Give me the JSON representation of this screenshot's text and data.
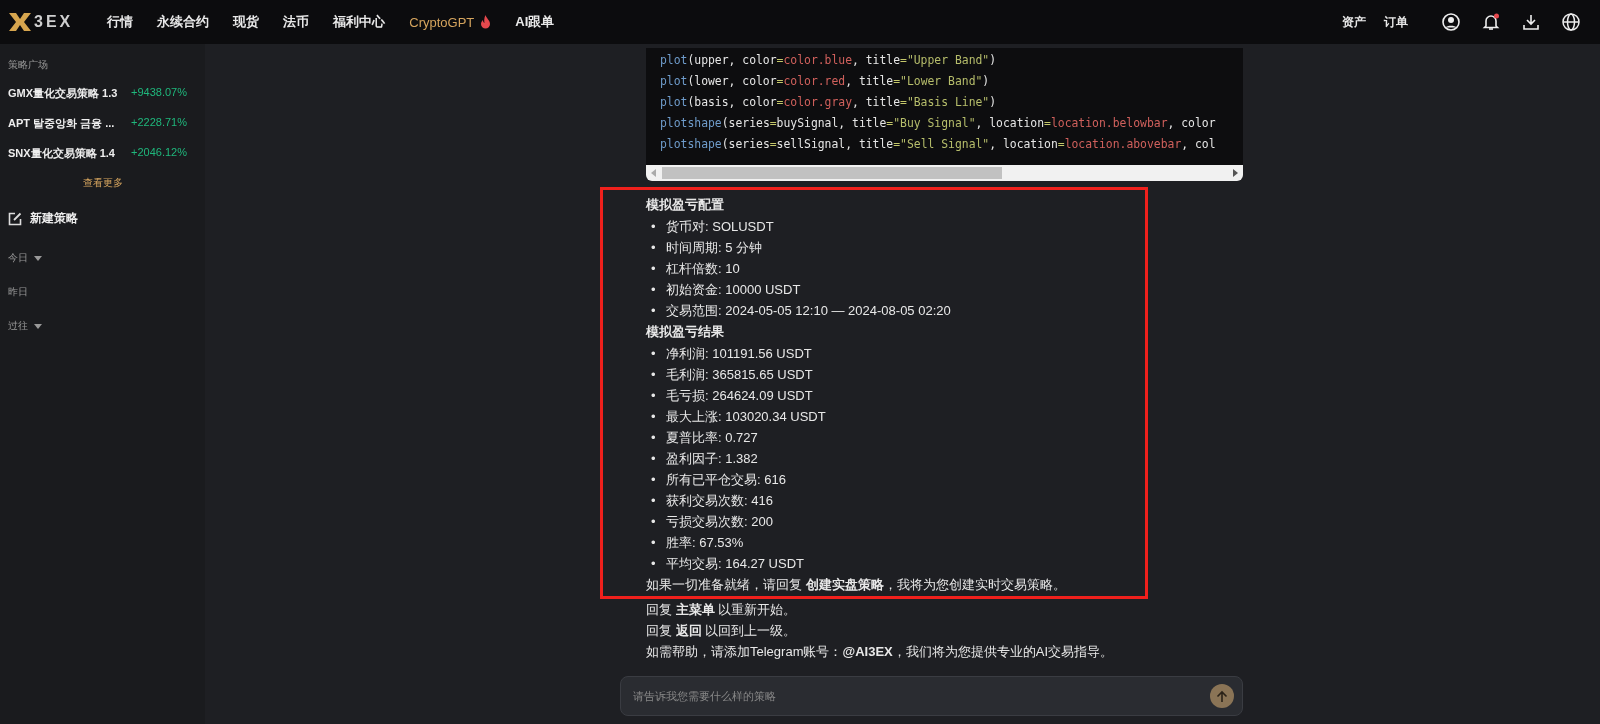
{
  "topbar": {
    "logo_text": "3EX",
    "nav": [
      {
        "label": "行情",
        "selected": false,
        "hot": false
      },
      {
        "label": "永续合约",
        "selected": false,
        "hot": false
      },
      {
        "label": "现货",
        "selected": false,
        "hot": false
      },
      {
        "label": "法币",
        "selected": false,
        "hot": false
      },
      {
        "label": "福利中心",
        "selected": false,
        "hot": false
      },
      {
        "label": "CryptoGPT",
        "selected": true,
        "hot": true
      },
      {
        "label": "AI跟单",
        "selected": false,
        "hot": false
      }
    ],
    "right_links": [
      "资产",
      "订单"
    ],
    "notification_dot": true
  },
  "sidebar": {
    "section_title": "策略广场",
    "strategies": [
      {
        "name": "GMX量化交易策略 1.3",
        "return": "+9438.07%"
      },
      {
        "name": "APT 탈중앙화 금융 ...",
        "return": "+2228.71%"
      },
      {
        "name": "SNX量化交易策略 1.4",
        "return": "+2046.12%"
      }
    ],
    "more_link": "查看更多",
    "new_strategy": "新建策略",
    "history": [
      {
        "label": "今日",
        "collapsible": true
      },
      {
        "label": "昨日",
        "collapsible": false
      },
      {
        "label": "过往",
        "collapsible": true
      }
    ]
  },
  "code_block": {
    "lines": [
      [
        {
          "text": "plot",
          "kind": "func"
        },
        {
          "text": "(upper, color",
          "kind": "plain"
        },
        {
          "text": "=",
          "kind": "op"
        },
        {
          "text": "color.blue",
          "kind": "value"
        },
        {
          "text": ", title",
          "kind": "plain"
        },
        {
          "text": "=",
          "kind": "op"
        },
        {
          "text": "\"Upper Band\"",
          "kind": "string"
        },
        {
          "text": ")",
          "kind": "plain"
        }
      ],
      [
        {
          "text": "plot",
          "kind": "func"
        },
        {
          "text": "(lower, color",
          "kind": "plain"
        },
        {
          "text": "=",
          "kind": "op"
        },
        {
          "text": "color.red",
          "kind": "value"
        },
        {
          "text": ", title",
          "kind": "plain"
        },
        {
          "text": "=",
          "kind": "op"
        },
        {
          "text": "\"Lower Band\"",
          "kind": "string"
        },
        {
          "text": ")",
          "kind": "plain"
        }
      ],
      [
        {
          "text": "plot",
          "kind": "func"
        },
        {
          "text": "(basis, color",
          "kind": "plain"
        },
        {
          "text": "=",
          "kind": "op"
        },
        {
          "text": "color.gray",
          "kind": "value"
        },
        {
          "text": ", title",
          "kind": "plain"
        },
        {
          "text": "=",
          "kind": "op"
        },
        {
          "text": "\"Basis Line\"",
          "kind": "string"
        },
        {
          "text": ")",
          "kind": "plain"
        }
      ],
      [
        {
          "text": "plotshape",
          "kind": "func"
        },
        {
          "text": "(series",
          "kind": "plain"
        },
        {
          "text": "=",
          "kind": "op"
        },
        {
          "text": "buySignal, title",
          "kind": "plain"
        },
        {
          "text": "=",
          "kind": "op"
        },
        {
          "text": "\"Buy Signal\"",
          "kind": "string"
        },
        {
          "text": ", location",
          "kind": "plain"
        },
        {
          "text": "=",
          "kind": "op"
        },
        {
          "text": "location.belowbar",
          "kind": "value"
        },
        {
          "text": ", color",
          "kind": "plain"
        }
      ],
      [
        {
          "text": "plotshape",
          "kind": "func"
        },
        {
          "text": "(series",
          "kind": "plain"
        },
        {
          "text": "=",
          "kind": "op"
        },
        {
          "text": "sellSignal, title",
          "kind": "plain"
        },
        {
          "text": "=",
          "kind": "op"
        },
        {
          "text": "\"Sell Signal\"",
          "kind": "string"
        },
        {
          "text": ", location",
          "kind": "plain"
        },
        {
          "text": "=",
          "kind": "op"
        },
        {
          "text": "location.abovebar",
          "kind": "value"
        },
        {
          "text": ", col",
          "kind": "plain"
        }
      ]
    ]
  },
  "result": {
    "sections": [
      {
        "heading": "模拟盈亏配置",
        "marker": "•",
        "items": [
          "货币对: SOLUSDT",
          "时间周期: 5 分钟",
          "杠杆倍数: 10",
          "初始资金: 10000 USDT",
          "交易范围: 2024-05-05 12:10 — 2024-08-05 02:20"
        ]
      },
      {
        "heading": "模拟盈亏结果",
        "marker": "•",
        "items": [
          "净利润: 101191.56 USDT",
          "毛利润: 365815.65 USDT",
          "毛亏损: 264624.09 USDT",
          "最大上涨: 103020.34 USDT",
          "夏普比率: 0.727",
          "盈利因子: 1.382",
          "所有已平仓交易: 616",
          "获利交易次数: 416",
          "亏损交易次数: 200",
          "胜率: 67.53%",
          "平均交易: 164.27 USDT"
        ]
      }
    ],
    "closing": "如果一切准备就绪，请回复 **创建实盘策略**，我将为您创建实时交易策略。"
  },
  "replies": [
    "回复 **主菜单** 以重新开始。",
    "回复 **返回** 以回到上一级。",
    "如需帮助，请添加Telegram账号：**@AI3EX**，我们将为您提供专业的AI交易指导。"
  ],
  "chat_input": {
    "placeholder": "请告诉我您需要什么样的策略"
  }
}
